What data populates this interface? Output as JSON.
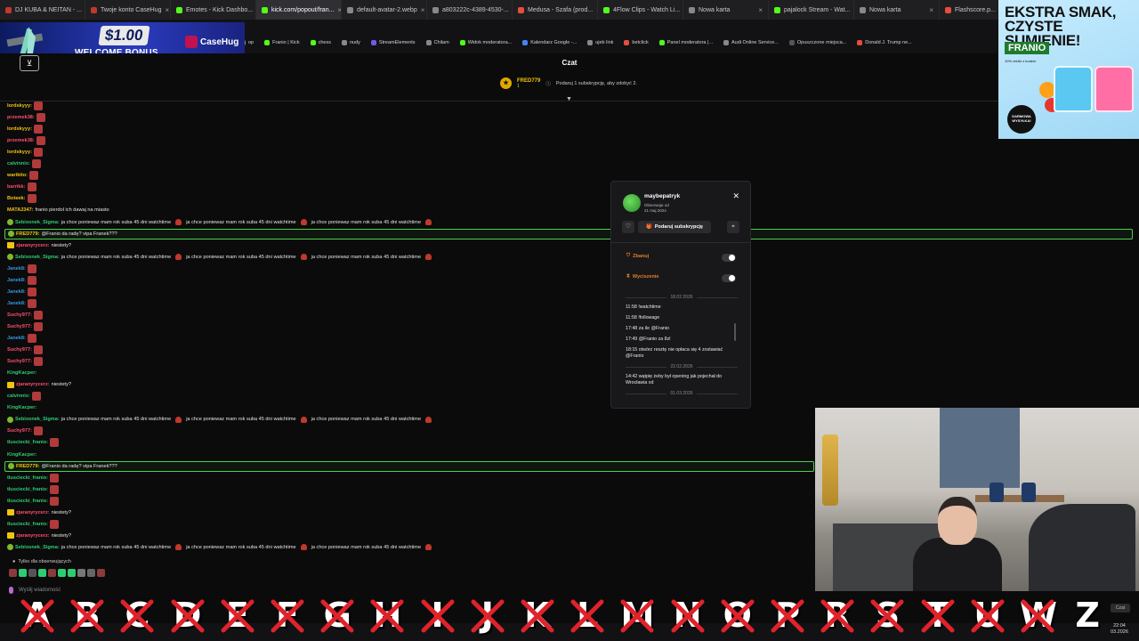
{
  "browser": {
    "tabs": [
      {
        "label": "DJ KUBA & NEITAN - ...",
        "fav": "#c0392b",
        "active": false
      },
      {
        "label": "Twoje konto CaseHug",
        "fav": "#c0392b",
        "active": false
      },
      {
        "label": "Emotes - Kick Dashbo...",
        "fav": "#53fc18",
        "active": false
      },
      {
        "label": "kick.com/popout/fran...",
        "fav": "#53fc18",
        "active": true
      },
      {
        "label": "default-avatar-2.webp",
        "fav": "#888888",
        "active": false
      },
      {
        "label": "a803222c-4389-4530-...",
        "fav": "#888888",
        "active": false
      },
      {
        "label": "Medusa - Szafa (prod...",
        "fav": "#e74c3c",
        "active": false
      },
      {
        "label": "4Flow Clips - Watch Li...",
        "fav": "#53fc18",
        "active": false
      },
      {
        "label": "Nowa karta",
        "fav": "#888888",
        "active": false
      },
      {
        "label": "pajalock Stream - Wat...",
        "fav": "#53fc18",
        "active": false
      },
      {
        "label": "Nowa karta",
        "fav": "#888888",
        "active": false
      },
      {
        "label": "Flashscore.p...",
        "fav": "#e74c3c",
        "active": false
      }
    ],
    "bookmarks": [
      {
        "label": "op",
        "color": "#888888"
      },
      {
        "label": "Franio | Kick",
        "color": "#53fc18"
      },
      {
        "label": "chess",
        "color": "#53fc18"
      },
      {
        "label": "nudy",
        "color": "#888888"
      },
      {
        "label": "StreamElements",
        "color": "#6c5ce7"
      },
      {
        "label": "Chilam",
        "color": "#888888"
      },
      {
        "label": "Widok moderatora...",
        "color": "#53fc18"
      },
      {
        "label": "Kalendarz Google -...",
        "color": "#4285f4"
      },
      {
        "label": "ujeb link",
        "color": "#888888"
      },
      {
        "label": "betclick",
        "color": "#e74c3c"
      },
      {
        "label": "Panel moderatora |...",
        "color": "#53fc18"
      },
      {
        "label": "Audi Online Service...",
        "color": "#888888"
      },
      {
        "label": "Opuszczone miejsca...",
        "color": "#555555"
      },
      {
        "label": "Donald J. Trump ne...",
        "color": "#e74c3c"
      }
    ]
  },
  "banner": {
    "amount": "$1.00",
    "bonus": "WELCOME BONUS",
    "logo": "CaseHug"
  },
  "chat": {
    "title": "Czat",
    "pinned_user": "FRED779",
    "pinned_user_sub": "1",
    "pinned_text": "Podaruj 1 subskrypcję, aby zdobyć 2.",
    "messages": [
      {
        "name": "lordskyyy:",
        "color": "#f1c40f",
        "text": "",
        "emotes": 1
      },
      {
        "name": "przemek38:",
        "color": "#ff4d6d",
        "text": "",
        "emotes": 1
      },
      {
        "name": "lordskyyy:",
        "color": "#f1c40f",
        "text": "",
        "emotes": 1
      },
      {
        "name": "przemek38:",
        "color": "#ff4d6d",
        "text": "",
        "emotes": 1
      },
      {
        "name": "lordskyyy:",
        "color": "#f1c40f",
        "text": "",
        "emotes": 1
      },
      {
        "name": "calvinnix:",
        "color": "#2ecc71",
        "text": "",
        "emotes": 1
      },
      {
        "name": "warikito:",
        "color": "#f1c40f",
        "text": "",
        "emotes": 1
      },
      {
        "name": "barrikk:",
        "color": "#ff4d6d",
        "text": "",
        "emotes": 1
      },
      {
        "name": "Boteek:",
        "color": "#f1c40f",
        "text": "",
        "emotes": 1
      },
      {
        "name": "MATA2347:",
        "color": "#f1c40f",
        "text": "franio pierdol ich dawaj na miasto",
        "emotes": 0
      },
      {
        "name": "Sebixonek_Sigma:",
        "color": "#2ecc71",
        "text": "ja chce poniewaz mam rok suba 45 dni watchtime",
        "emotes": 0,
        "repeat": true
      },
      {
        "name": "FRED779:",
        "color": "#f1c40f",
        "text": "@Franio da radę? vipa Franek???",
        "emotes": 0,
        "highlight": "full"
      },
      {
        "name": "zjaranyrycerz:",
        "color": "#ff4d6d",
        "text": "niestety?",
        "emotes": 0
      },
      {
        "name": "Sebixonek_Sigma:",
        "color": "#2ecc71",
        "text": "ja chce poniewaz mam rok suba 45 dni watchtime",
        "emotes": 0,
        "repeat": true
      },
      {
        "name": "Janek8:",
        "color": "#3498db",
        "text": "",
        "emotes": 1
      },
      {
        "name": "Janek8:",
        "color": "#3498db",
        "text": "",
        "emotes": 1
      },
      {
        "name": "Janek8:",
        "color": "#3498db",
        "text": "",
        "emotes": 1
      },
      {
        "name": "Janek8:",
        "color": "#3498db",
        "text": "",
        "emotes": 1
      },
      {
        "name": "Suchy977:",
        "color": "#ff4d6d",
        "text": "",
        "emotes": 1
      },
      {
        "name": "Suchy977:",
        "color": "#ff4d6d",
        "text": "",
        "emotes": 1
      },
      {
        "name": "Janek8:",
        "color": "#3498db",
        "text": "",
        "emotes": 1
      },
      {
        "name": "Suchy977:",
        "color": "#ff4d6d",
        "text": "",
        "emotes": 1
      },
      {
        "name": "Suchy977:",
        "color": "#ff4d6d",
        "text": "",
        "emotes": 1
      },
      {
        "name": "KingKacper:",
        "color": "#2ecc71",
        "text": "",
        "emotes": 0
      },
      {
        "name": "zjaranyrycerz:",
        "color": "#ff4d6d",
        "text": "niestety?",
        "emotes": 0
      },
      {
        "name": "calvinnix:",
        "color": "#2ecc71",
        "text": "",
        "emotes": 1
      },
      {
        "name": "KingKacper:",
        "color": "#2ecc71",
        "text": "",
        "emotes": 0
      },
      {
        "name": "Sebixonek_Sigma:",
        "color": "#2ecc71",
        "text": "ja chce poniewaz mam rok suba 45 dni watchtime",
        "emotes": 0,
        "repeat": true
      },
      {
        "name": "Suchy977:",
        "color": "#ff4d6d",
        "text": "",
        "emotes": 1
      },
      {
        "name": "tlusciecki_franio:",
        "color": "#2ecc71",
        "text": "",
        "emotes": 1
      },
      {
        "name": "KingKacper:",
        "color": "#2ecc71",
        "text": "",
        "emotes": 0
      },
      {
        "name": "FRED779:",
        "color": "#f1c40f",
        "text": "@Franio da radę? vipa Franek???",
        "emotes": 0,
        "highlight": "partial"
      },
      {
        "name": "tlusciecki_franio:",
        "color": "#2ecc71",
        "text": "",
        "emotes": 1
      },
      {
        "name": "tlusciecki_franio:",
        "color": "#2ecc71",
        "text": "",
        "emotes": 1
      },
      {
        "name": "tlusciecki_franio:",
        "color": "#2ecc71",
        "text": "",
        "emotes": 1
      },
      {
        "name": "zjaranyrycerz:",
        "color": "#ff4d6d",
        "text": "niestety?",
        "emotes": 0
      },
      {
        "name": "tlusciecki_franio:",
        "color": "#2ecc71",
        "text": "",
        "emotes": 1
      },
      {
        "name": "zjaranyrycerz:",
        "color": "#ff4d6d",
        "text": "niestety?",
        "emotes": 0
      },
      {
        "name": "Sebixonek_Sigma:",
        "color": "#2ecc71",
        "text": "ja chce poniewaz mam rok suba 45 dni watchtime",
        "emotes": 0,
        "repeat": true
      }
    ],
    "subonly": "Tylko dla obserwujących",
    "input_placeholder": "Wyślij wiadomość"
  },
  "popup": {
    "username": "maybepatryk",
    "since_label": "Obserwuje od",
    "since_date": "21 maj 2024",
    "gift_label": "Podaruj subskrypcję",
    "ban_label": "Zbanuj",
    "mute_label": "Wyciszenie",
    "history": [
      {
        "date": "18.02.2026"
      },
      {
        "entry": "11:58 !watchtime"
      },
      {
        "entry": "11:58 !followage"
      },
      {
        "entry": "17:48 za ile @Franio"
      },
      {
        "entry": "17:49 @Franio za 8zl"
      },
      {
        "entry": "18:15 otwórz resztę nie opłaca się 4 zostawiać @Franio"
      },
      {
        "date": "22.02.2026"
      },
      {
        "entry": "14:42 wątpię żeby był opening jak pojechał do Wrocławia xd"
      },
      {
        "date": "01.03.2026"
      }
    ]
  },
  "ad": {
    "headline1": "EKSTRA SMAK,",
    "headline2": "CZYSTE SUMIENIE!",
    "brand": "FRANIO",
    "discount": "10% zniżki z kodem",
    "stamp": "DARMOWA WYSYŁKA!"
  },
  "overlay": {
    "letters": [
      "A",
      "B",
      "C",
      "D",
      "E",
      "F",
      "G",
      "H",
      "I",
      "J",
      "K",
      "L",
      "M",
      "N",
      "O",
      "P",
      "R",
      "S",
      "T",
      "U",
      "W",
      "Z"
    ],
    "crossed": [
      true,
      true,
      true,
      true,
      true,
      true,
      true,
      true,
      true,
      true,
      true,
      true,
      true,
      true,
      true,
      true,
      true,
      true,
      true,
      true,
      true,
      false
    ],
    "badge": "Czat"
  },
  "clock": {
    "time": "22:04",
    "date": "03.2026"
  }
}
